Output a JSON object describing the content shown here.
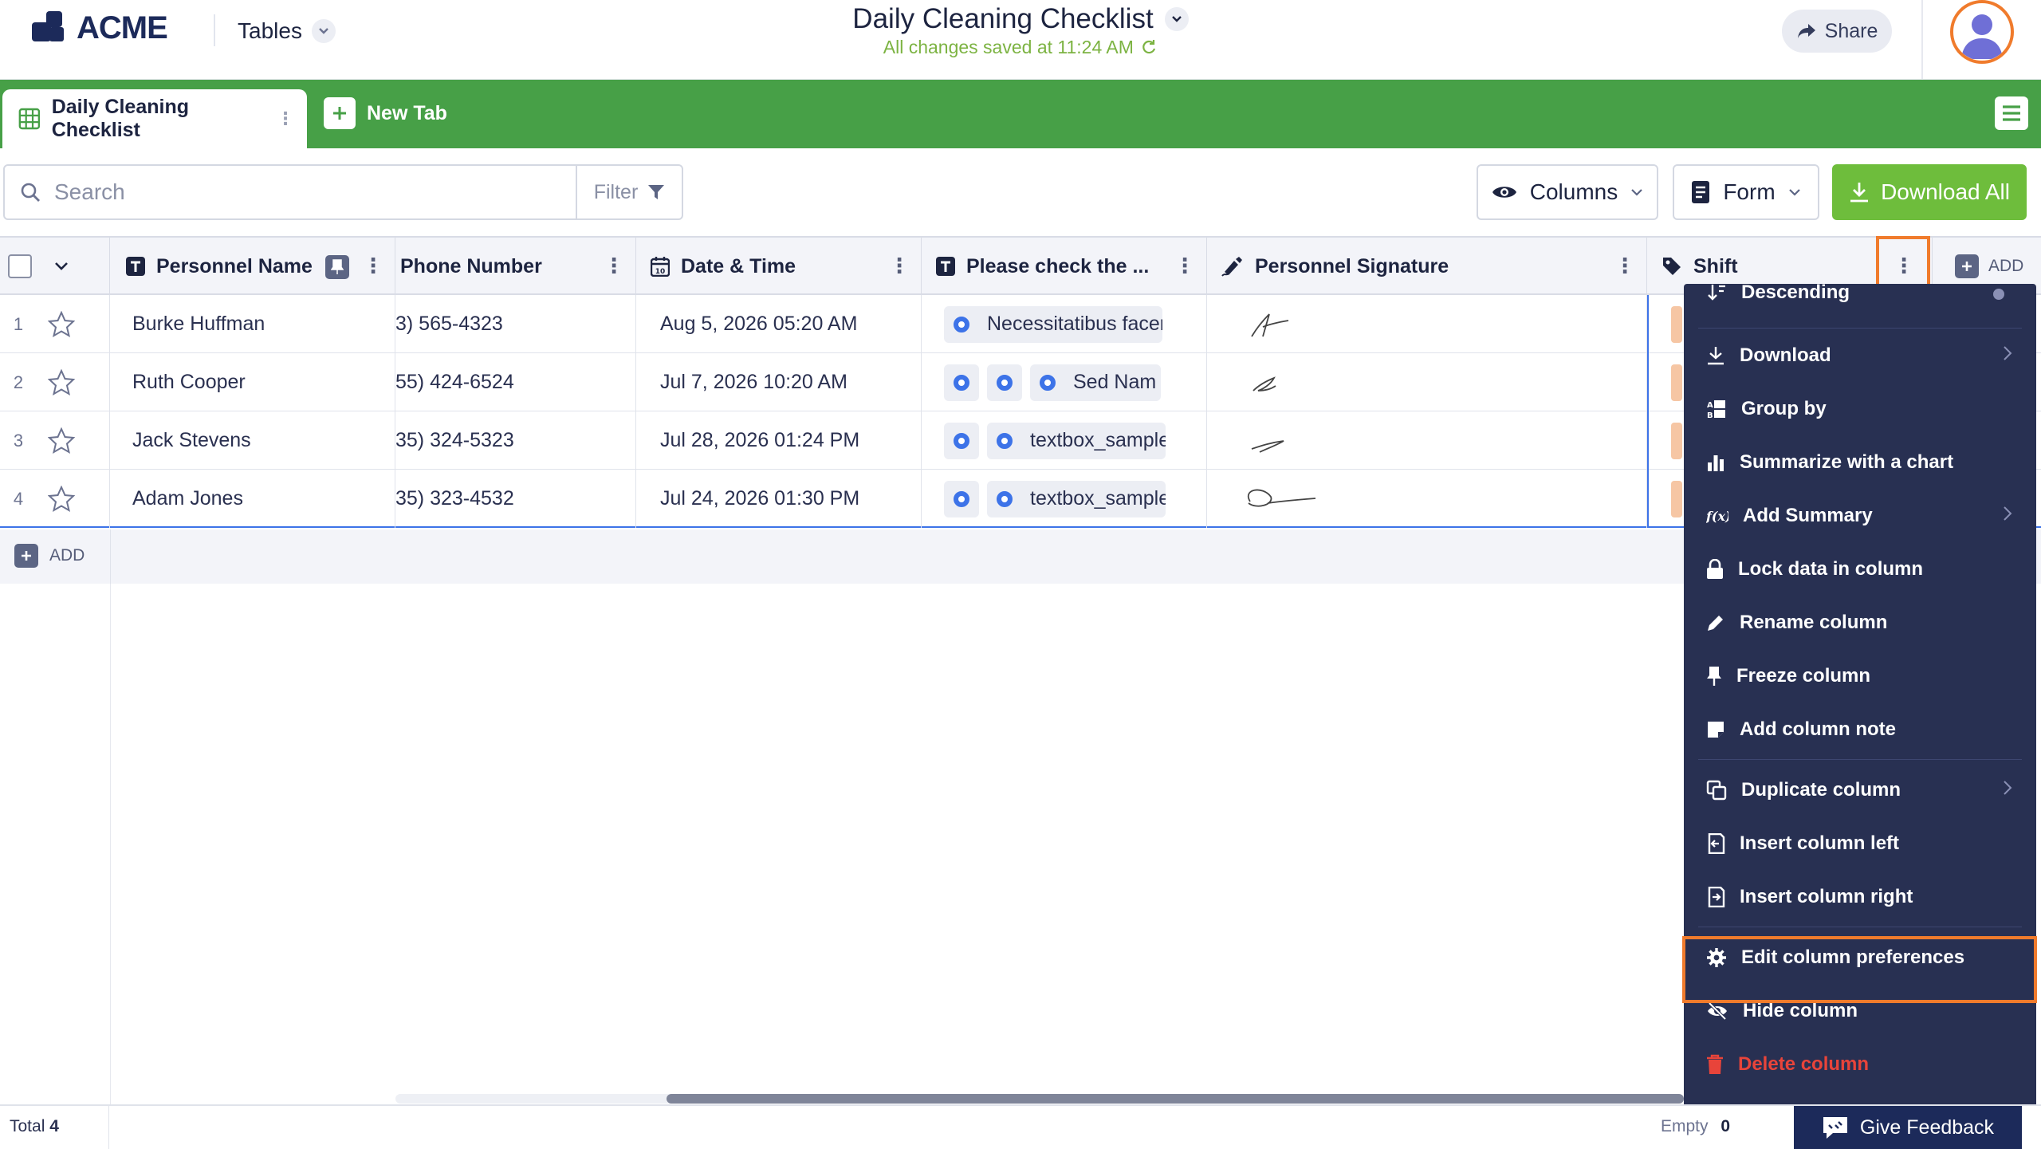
{
  "app": {
    "logo_text": "ACME",
    "nav_label": "Tables",
    "doc_title": "Daily Cleaning Checklist",
    "saved_status": "All changes saved at 11:24 AM",
    "share_label": "Share"
  },
  "tabs": {
    "active_label": "Daily Cleaning Checklist",
    "new_tab_label": "New Tab"
  },
  "toolbar": {
    "search_placeholder": "Search",
    "filter_label": "Filter",
    "columns_label": "Columns",
    "form_label": "Form",
    "download_all_label": "Download All"
  },
  "columns": {
    "name": "Personnel Name",
    "phone": "Phone Number",
    "datetime": "Date & Time",
    "check": "Please check the ...",
    "signature": "Personnel Signature",
    "shift": "Shift",
    "add": "ADD"
  },
  "rows": [
    {
      "num": "1",
      "name": "Burke Huffman",
      "phone": "3) 565-4323",
      "date": "Aug 5, 2026 05:20 AM",
      "check_text": "Necessitatibus facer"
    },
    {
      "num": "2",
      "name": "Ruth Cooper",
      "phone": "55) 424-6524",
      "date": "Jul 7, 2026 10:20 AM",
      "check_text": "Sed Nam e"
    },
    {
      "num": "3",
      "name": "Jack Stevens",
      "phone": "35) 324-5323",
      "date": "Jul 28, 2026 01:24 PM",
      "check_text": "textbox_sample"
    },
    {
      "num": "4",
      "name": "Adam Jones",
      "phone": "35) 323-4532",
      "date": "Jul 24, 2026 01:30 PM",
      "check_text": "textbox_sample"
    }
  ],
  "add_row_label": "ADD",
  "menu": {
    "descending": "Descending",
    "download": "Download",
    "group_by": "Group by",
    "summarize": "Summarize with a chart",
    "add_summary": "Add Summary",
    "lock": "Lock data in column",
    "rename": "Rename column",
    "freeze": "Freeze column",
    "note": "Add column note",
    "duplicate": "Duplicate column",
    "insert_left": "Insert column left",
    "insert_right": "Insert column right",
    "edit_prefs": "Edit column preferences",
    "hide": "Hide column",
    "delete": "Delete column"
  },
  "footer": {
    "total_label": "Total",
    "total_value": "4",
    "empty_label": "Empty",
    "empty_value": "0",
    "feedback_label": "Give Feedback"
  },
  "colors": {
    "brand_green": "#47a047",
    "download_green": "#6ebd3c",
    "highlight_orange": "#f07b2c",
    "menu_bg": "#283052",
    "radio_blue": "#3d73e8",
    "delete_red": "#e8443a"
  }
}
